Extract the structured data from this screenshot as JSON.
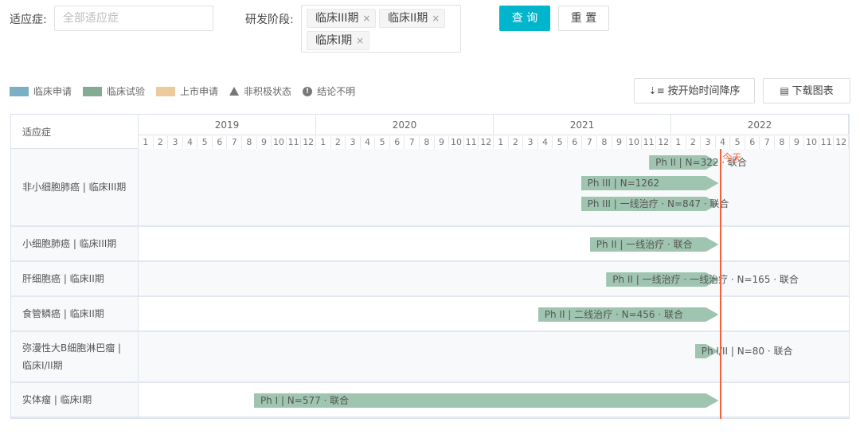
{
  "filters": {
    "indication_label": "适应症:",
    "indication_placeholder": "全部适应症",
    "phase_label": "研发阶段:",
    "phase_tags": [
      "临床III期",
      "临床II期",
      "临床I期"
    ],
    "tag_close": "×",
    "query_button": "查 询",
    "reset_button": "重 置"
  },
  "legend": [
    {
      "label": "临床申请",
      "color": "#7aafc4"
    },
    {
      "label": "临床试验",
      "color": "#86ab94"
    },
    {
      "label": "上市申请",
      "color": "#eecb9c"
    },
    {
      "label": "非积极状态",
      "icon": "triangle"
    },
    {
      "label": "结论不明",
      "icon": "exclamation"
    }
  ],
  "toolbar": {
    "sort_button": "按开始时间降序",
    "download_button": "下载图表"
  },
  "table": {
    "header": "适应症",
    "years": [
      "2019",
      "2020",
      "2021",
      "2022"
    ],
    "months": [
      "1",
      "2",
      "3",
      "4",
      "5",
      "6",
      "7",
      "8",
      "9",
      "10",
      "11",
      "12"
    ],
    "today_label": "今天",
    "today_month": 39.3,
    "rows": [
      {
        "label": "非小细胞肺癌 | 临床III期",
        "bars": [
          {
            "start": 34.5,
            "end": 39.2,
            "text": "Ph II | N=322 · 联合"
          },
          {
            "start": 29.9,
            "end": 39.2,
            "text": "Ph III | N=1262"
          },
          {
            "start": 29.9,
            "end": 39.2,
            "text": "Ph III | 一线治疗 · N=847 · 联合"
          }
        ]
      },
      {
        "label": "小细胞肺癌 | 临床III期",
        "bars": [
          {
            "start": 30.5,
            "end": 39.2,
            "text": "Ph II | 一线治疗 · 联合"
          }
        ]
      },
      {
        "label": "肝细胞癌 | 临床II期",
        "bars": [
          {
            "start": 31.6,
            "end": 39.2,
            "text": "Ph II | 一线治疗 · 一线治疗 · N=165 · 联合"
          }
        ]
      },
      {
        "label": "食管鳞癌 | 临床II期",
        "bars": [
          {
            "start": 27.0,
            "end": 39.2,
            "text": "Ph II | 二线治疗 · N=456 · 联合"
          }
        ]
      },
      {
        "label": "弥漫性大B细胞淋巴瘤 | 临床I/II期",
        "bars": [
          {
            "start": 37.6,
            "end": 39.2,
            "text": "Ph I/II | N=80 · 联合"
          }
        ]
      },
      {
        "label": "实体瘤 | 临床I期",
        "bars": [
          {
            "start": 7.8,
            "end": 39.2,
            "text": "Ph I | N=577 · 联合"
          }
        ]
      }
    ]
  }
}
